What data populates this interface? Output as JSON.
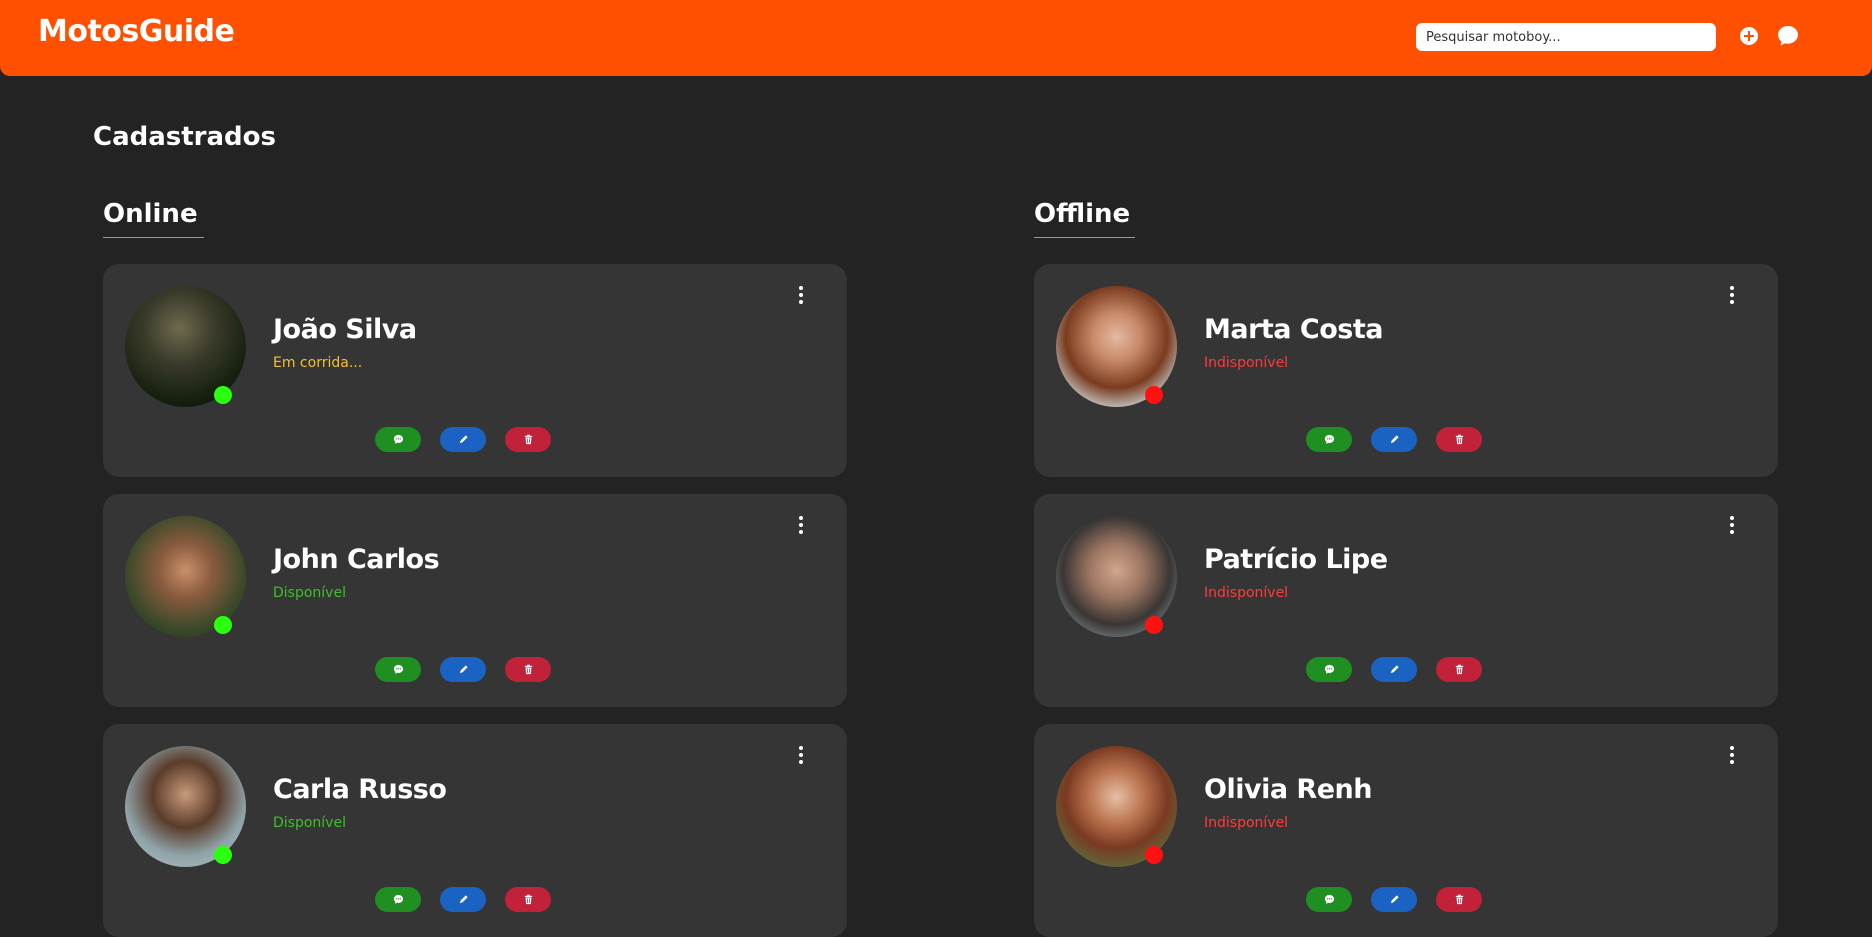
{
  "header": {
    "logo": "MotosGuide",
    "search_placeholder": "Pesquisar motoboy..."
  },
  "page_title": "Cadastrados",
  "colors": {
    "brand": "#ff4f00",
    "online_dot": "#29ff0f",
    "offline_dot": "#ff1111",
    "status_busy": "#f2c230",
    "status_available": "#3fbf2a",
    "status_unavailable": "#ff3b3b"
  },
  "columns": {
    "online": {
      "title": "Online",
      "cards": [
        {
          "name": "João Silva",
          "status": "Em corrida...",
          "status_type": "busy",
          "avatar_icon": "man-rider-photo"
        },
        {
          "name": "John Carlos",
          "status": "Disponível",
          "status_type": "available",
          "avatar_icon": "young-man-photo"
        },
        {
          "name": "Carla Russo",
          "status": "Disponível",
          "status_type": "available",
          "avatar_icon": "woman-curly-hair-photo"
        }
      ]
    },
    "offline": {
      "title": "Offline",
      "cards": [
        {
          "name": "Marta Costa",
          "status": "Indisponível",
          "status_type": "unavailable",
          "avatar_icon": "woman-red-hair-photo"
        },
        {
          "name": "Patrício Lipe",
          "status": "Indisponível",
          "status_type": "unavailable",
          "avatar_icon": "man-portrait-photo"
        },
        {
          "name": "Olivia Renh",
          "status": "Indisponível",
          "status_type": "unavailable",
          "avatar_icon": "woman-auburn-hair-photo"
        }
      ]
    }
  },
  "card_actions": {
    "chat_icon": "chat-icon",
    "edit_icon": "pencil-icon",
    "delete_icon": "trash-icon",
    "menu_icon": "kebab-menu-icon"
  }
}
